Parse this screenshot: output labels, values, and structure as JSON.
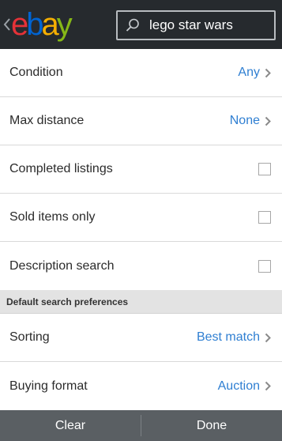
{
  "header": {
    "back_icon": "chevron-left-icon",
    "logo": {
      "letters": [
        {
          "char": "e",
          "color": "#e53238"
        },
        {
          "char": "b",
          "color": "#0064d2"
        },
        {
          "char": "a",
          "color": "#f5af02"
        },
        {
          "char": "y",
          "color": "#86b817"
        }
      ]
    },
    "search": {
      "icon": "search-icon",
      "value": "lego star wars"
    }
  },
  "rows": [
    {
      "label": "Condition",
      "type": "nav",
      "value": "Any"
    },
    {
      "label": "Max distance",
      "type": "nav",
      "value": "None"
    },
    {
      "label": "Completed listings",
      "type": "checkbox",
      "checked": false
    },
    {
      "label": "Sold items only",
      "type": "checkbox",
      "checked": false
    },
    {
      "label": "Description search",
      "type": "checkbox",
      "checked": false
    }
  ],
  "section": {
    "title": "Default search preferences"
  },
  "pref_rows": [
    {
      "label": "Sorting",
      "type": "nav",
      "value": "Best match"
    },
    {
      "label": "Buying format",
      "type": "nav",
      "value": "Auction"
    }
  ],
  "footer": {
    "clear_label": "Clear",
    "done_label": "Done"
  },
  "colors": {
    "accent_link": "#2f7fd2",
    "header_bg": "#262a2e",
    "footer_bg": "#5a5f63"
  }
}
